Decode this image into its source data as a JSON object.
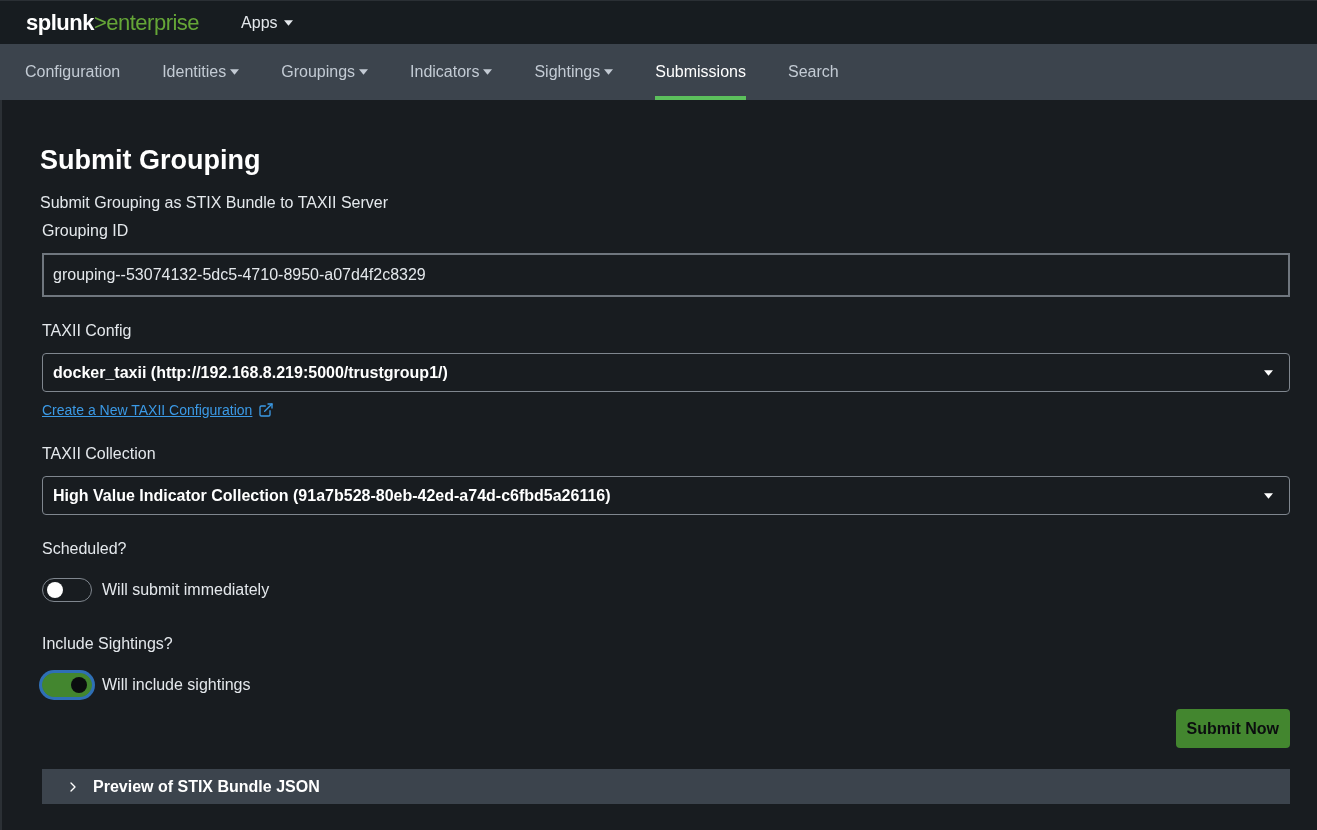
{
  "header": {
    "logo": {
      "brand": "splunk",
      "separator": ">",
      "product": "enterprise"
    },
    "apps_menu": {
      "label": "Apps"
    }
  },
  "nav": [
    {
      "label": "Configuration",
      "has_menu": false,
      "selected": false
    },
    {
      "label": "Identities",
      "has_menu": true,
      "selected": false
    },
    {
      "label": "Groupings",
      "has_menu": true,
      "selected": false
    },
    {
      "label": "Indicators",
      "has_menu": true,
      "selected": false
    },
    {
      "label": "Sightings",
      "has_menu": true,
      "selected": false
    },
    {
      "label": "Submissions",
      "has_menu": false,
      "selected": true
    },
    {
      "label": "Search",
      "has_menu": false,
      "selected": false
    }
  ],
  "page": {
    "title": "Submit Grouping",
    "subtitle": "Submit Grouping as STIX Bundle to TAXII Server"
  },
  "fields": [
    {
      "kind": "text",
      "label": "Grouping ID",
      "value": "grouping--53074132-5dc5-4710-8950-a07d4f2c8329"
    },
    {
      "kind": "select",
      "label": "TAXII Config",
      "value": "docker_taxii (http://192.168.8.219:5000/trustgroup1/)",
      "link": "Create a New TAXII Configuration"
    },
    {
      "kind": "select",
      "label": "TAXII Collection",
      "value": "High Value Indicator Collection (91a7b528-80eb-42ed-a74d-c6fbd5a26116)"
    },
    {
      "kind": "switch",
      "label": "Scheduled?",
      "on": false,
      "focused": false,
      "caption": "Will submit immediately"
    },
    {
      "kind": "switch",
      "label": "Include Sightings?",
      "on": true,
      "focused": true,
      "caption": "Will include sightings"
    }
  ],
  "submit_button": {
    "label": "Submit Now"
  },
  "preview": {
    "title": "Preview of STIX Bundle JSON",
    "expanded": false
  }
}
